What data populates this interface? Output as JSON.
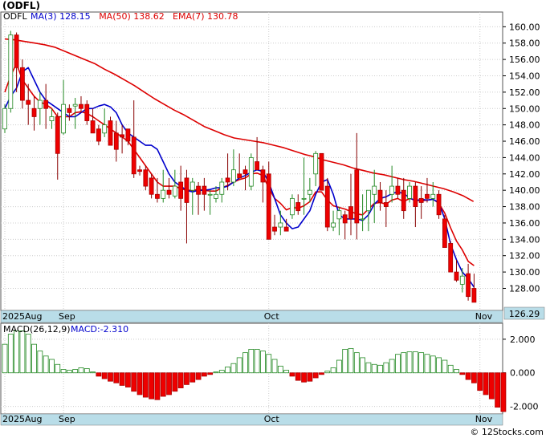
{
  "chart_data": [
    {
      "type": "candlestick",
      "title": "(ODFL)",
      "indicators": [
        {
          "label": "MA(3)",
          "value": "128.15",
          "color": "#0000cc"
        },
        {
          "label": "MA(50)",
          "value": "138.62",
          "color": "#dd0000"
        },
        {
          "label": "EMA(7)",
          "value": "130.78",
          "color": "#dd0000"
        }
      ],
      "ylim": [
        125.3,
        161.8
      ],
      "yticks": [
        128,
        130,
        132,
        134,
        136,
        138,
        140,
        142,
        144,
        146,
        148,
        150,
        152,
        154,
        156,
        158,
        160
      ],
      "ytick_labels": [
        "128.00",
        "130.00",
        "132.00",
        "134.00",
        "136.00",
        "138.00",
        "140.00",
        "142.00",
        "144.00",
        "146.00",
        "148.00",
        "150.00",
        "152.00",
        "154.00",
        "156.00",
        "158.00",
        "160.00"
      ],
      "last_price": "126.29",
      "x_labels": [
        {
          "label": "2025Aug",
          "index": 0
        },
        {
          "label": "Sep",
          "index": 10
        },
        {
          "label": "Oct",
          "index": 45
        },
        {
          "label": "Nov",
          "index": 81
        }
      ],
      "grid": true,
      "ohlc": [
        [
          147.5,
          150.5,
          147,
          150
        ],
        [
          150,
          159.5,
          149.5,
          159
        ],
        [
          159,
          159.3,
          152,
          155
        ],
        [
          155,
          156,
          150,
          151
        ],
        [
          151,
          153,
          148,
          150.5
        ],
        [
          150,
          151.5,
          147.3,
          149
        ],
        [
          150,
          152,
          148,
          151
        ],
        [
          151,
          153,
          147.5,
          150
        ],
        [
          148.5,
          150,
          147.5,
          149
        ],
        [
          149,
          149.5,
          141.3,
          144.5
        ],
        [
          147,
          153.5,
          146.8,
          150.5
        ],
        [
          150,
          150.5,
          148.5,
          149.5
        ],
        [
          150.3,
          151.3,
          147.5,
          150.5
        ],
        [
          150.5,
          151.5,
          149.5,
          150
        ],
        [
          150.5,
          151,
          148,
          148.5
        ],
        [
          148.5,
          150,
          147.5,
          147
        ],
        [
          147.5,
          148,
          145.5,
          146
        ],
        [
          147,
          150,
          146.5,
          148
        ],
        [
          148.5,
          149,
          145.5,
          145.5
        ],
        [
          147,
          148.5,
          143.5,
          145
        ],
        [
          146.8,
          148,
          144.5,
          146.5
        ],
        [
          147.5,
          147.5,
          145.5,
          146
        ],
        [
          146.5,
          151,
          141.5,
          142
        ],
        [
          142.5,
          143,
          141.8,
          142.3
        ],
        [
          142.5,
          143,
          140,
          140.5
        ],
        [
          141.5,
          142,
          139,
          139.5
        ],
        [
          139.5,
          141.5,
          138.5,
          139
        ],
        [
          139,
          142.5,
          138.5,
          140
        ],
        [
          140,
          141.5,
          139,
          139.5
        ],
        [
          139.3,
          142.5,
          139,
          140.5
        ],
        [
          141,
          143,
          137.5,
          139
        ],
        [
          141.5,
          142.5,
          133.5,
          138.5
        ],
        [
          140,
          141.5,
          137,
          141
        ],
        [
          140.5,
          141,
          137,
          139.5
        ],
        [
          140.5,
          141.5,
          137.5,
          139.5
        ],
        [
          139.5,
          140,
          137,
          139.5
        ],
        [
          139,
          140.5,
          138.5,
          139.5
        ],
        [
          139.5,
          141.5,
          138.5,
          141
        ],
        [
          141.5,
          144.5,
          140,
          141
        ],
        [
          141,
          145,
          140.5,
          142.5
        ],
        [
          142,
          144.5,
          141.5,
          141.5
        ],
        [
          142.5,
          143,
          140,
          142
        ],
        [
          140.5,
          144.5,
          140,
          144
        ],
        [
          143.5,
          146.5,
          142.5,
          142.5
        ],
        [
          142.5,
          143,
          138.5,
          141
        ],
        [
          142,
          143.5,
          134,
          134
        ],
        [
          135.5,
          137,
          134.5,
          135
        ],
        [
          135.5,
          137.5,
          134.5,
          136
        ],
        [
          135.5,
          136.5,
          135,
          135
        ],
        [
          137,
          139.5,
          136.5,
          139
        ],
        [
          138.5,
          139.5,
          137,
          137.5
        ],
        [
          139,
          144,
          137,
          139
        ],
        [
          139.5,
          141.5,
          138.5,
          140
        ],
        [
          142,
          144.8,
          140.5,
          144.5
        ],
        [
          144.5,
          144.5,
          140,
          140
        ],
        [
          140.5,
          141.5,
          135,
          135.5
        ],
        [
          135.5,
          137.5,
          135,
          136
        ],
        [
          136.5,
          138,
          134.5,
          137.5
        ],
        [
          137,
          137.5,
          134,
          136
        ],
        [
          138,
          142,
          134.5,
          136.5
        ],
        [
          142.5,
          147,
          134,
          136
        ],
        [
          136.5,
          139.5,
          135,
          136.5
        ],
        [
          137.5,
          140,
          135,
          140
        ],
        [
          139.5,
          142.5,
          136,
          140.5
        ],
        [
          140,
          141,
          137.5,
          138.5
        ],
        [
          138.5,
          140,
          135.5,
          138
        ],
        [
          139.5,
          143,
          138.5,
          140.5
        ],
        [
          140.5,
          141.5,
          139,
          139.5
        ],
        [
          140,
          141.5,
          136.5,
          137.5
        ],
        [
          139,
          141,
          138.5,
          140.5
        ],
        [
          140.5,
          141,
          135.5,
          138
        ],
        [
          139,
          140.5,
          136.5,
          138.5
        ],
        [
          139.5,
          141.5,
          138.5,
          139
        ],
        [
          139,
          141,
          138,
          139.5
        ],
        [
          139.5,
          140,
          136.5,
          137
        ],
        [
          136.5,
          137,
          133.3,
          133
        ],
        [
          133.5,
          133.8,
          130,
          130
        ],
        [
          130,
          131.5,
          128.8,
          129
        ],
        [
          128.5,
          130.5,
          127.5,
          129.5
        ],
        [
          129.8,
          131,
          126.5,
          127
        ],
        [
          128,
          129.8,
          126.3,
          126.3
        ]
      ],
      "ma3": [
        150,
        151.5,
        152.5,
        154.5,
        155,
        153.5,
        152,
        151,
        150.5,
        150,
        149.5,
        149,
        149,
        149.5,
        150,
        150,
        150.3,
        150.5,
        150.2,
        149.5,
        148,
        147,
        146.5,
        146,
        145.5,
        145.5,
        145,
        143.5,
        142,
        141,
        140.5,
        140,
        139.8,
        140,
        140,
        140.1,
        140.3,
        140.3,
        140.5,
        141,
        141.5,
        141.8,
        142.2,
        142.5,
        142.3,
        141,
        139,
        137,
        136,
        135.3,
        135.5,
        136.5,
        137.5,
        139.5,
        141,
        141.3,
        139.5,
        137,
        136.5,
        136.5,
        136.5,
        136.3,
        137,
        138.3,
        139,
        139.2,
        139.6,
        139.8,
        139.6,
        139.1,
        138.7,
        138.9,
        138.8,
        138.9,
        138.5,
        136.5,
        133.4,
        131.5,
        130,
        129.2,
        128.15
      ],
      "ema7": [
        152,
        154,
        155.5,
        153.5,
        152.5,
        151.5,
        150.8,
        150.5,
        150,
        149,
        149,
        149,
        149.5,
        149.6,
        149.4,
        149,
        148.5,
        148,
        147.5,
        147,
        146.5,
        146,
        145,
        144,
        143,
        142,
        141,
        140.5,
        140.5,
        140.5,
        140.2,
        140,
        140,
        140.1,
        140,
        139.9,
        139.9,
        140.3,
        140.6,
        141,
        141.3,
        141.5,
        142,
        142.1,
        141.8,
        140.3,
        139,
        138.4,
        137.6,
        137.9,
        137.8,
        138.1,
        138.6,
        139.8,
        139.8,
        138.8,
        138.1,
        137.9,
        137.7,
        137.4,
        137.1,
        137,
        137.7,
        138.4,
        138.5,
        138.3,
        138.8,
        139,
        138.6,
        139,
        138.8,
        138.7,
        138.8,
        138.9,
        138.4,
        137.2,
        135.4,
        133.8,
        132.7,
        131.3,
        130.78
      ],
      "ma50": {
        "start_index": 0,
        "values": [
          158.5,
          158.4,
          158.2,
          158,
          157.8,
          157.5,
          157,
          156.5,
          156,
          155.5,
          154.8,
          154.2,
          153.5,
          152.8,
          152,
          151.2,
          150.5,
          149.8,
          149.2,
          148.5,
          147.8,
          147.3,
          146.8,
          146.4,
          146.2,
          146,
          145.8,
          145.5,
          145.2,
          144.8,
          144.4,
          144.1,
          143.7,
          143.4,
          143.1,
          142.7,
          142.4,
          142.1,
          141.9,
          141.6,
          141.3,
          141.1,
          140.8,
          140.5,
          140.2,
          139.8,
          139.3,
          138.62
        ],
        "index_step": 1.7
      },
      "macd_label": "MACD(26,12,9)",
      "macd_value": "-2.310",
      "macd_yticks": [
        2,
        0,
        -2
      ],
      "macd_ytick_labels": [
        "2.000",
        "0.000",
        "-2.000"
      ],
      "macd_ylim": [
        -2.45,
        2.95
      ],
      "macd_hist": [
        1.7,
        2.3,
        2.5,
        2.5,
        2.3,
        1.7,
        1.3,
        1,
        0.8,
        0.5,
        0.2,
        0.15,
        0.2,
        0.3,
        0.25,
        0.05,
        -0.2,
        -0.35,
        -0.5,
        -0.6,
        -0.75,
        -0.85,
        -1.1,
        -1.3,
        -1.45,
        -1.55,
        -1.6,
        -1.4,
        -1.3,
        -1.1,
        -0.9,
        -0.7,
        -0.55,
        -0.4,
        -0.2,
        -0.1,
        0.05,
        0.15,
        0.35,
        0.55,
        0.9,
        1.2,
        1.4,
        1.4,
        1.3,
        1.1,
        0.8,
        0.4,
        0.15,
        -0.2,
        -0.45,
        -0.55,
        -0.5,
        -0.3,
        -0.1,
        0.1,
        0.3,
        0.75,
        1.4,
        1.45,
        1.2,
        0.9,
        0.6,
        0.5,
        0.45,
        0.6,
        0.8,
        1.1,
        1.2,
        1.25,
        1.25,
        1.2,
        1.1,
        1,
        0.9,
        0.75,
        0.45,
        0.2,
        -0.1,
        -0.4,
        -0.6,
        -1.05,
        -1.3,
        -1.55,
        -2.05,
        -2.31
      ]
    }
  ],
  "watermark": "© 12Stocks.com"
}
